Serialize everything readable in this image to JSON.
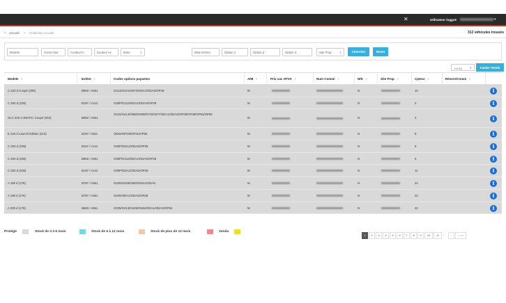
{
  "topbar": {
    "user_label": "Utilisateur loggué",
    "caret": "▾",
    "logo": "✕"
  },
  "breadcrumb": {
    "home": "Accueil",
    "separator": ">",
    "current": "Collection Accueil",
    "count_label": "312 véhicules trouvés"
  },
  "filters": {
    "fields": [
      "Modele",
      "Comm Nur",
      "Couleur in",
      "Couleur ex",
      "Boite",
      "Date Entree",
      "Option 1",
      "Option 2",
      "Option 3",
      "Site Prop"
    ],
    "search_label": "Chercher",
    "reset_label": "Reset"
  },
  "table_controls": {
    "lot": "Lot 10",
    "hide_label": "Cacher Vendu"
  },
  "columns": [
    "Modele",
    "Ext/Int",
    "Codes options payantes",
    "A/M",
    "Prix cat. HTVA",
    "Num Commi",
    "N/D",
    "Site Prop",
    "Cpteur",
    "Réserv/Comm"
  ],
  "rows": [
    {
      "modele": "C 220 d Coupé (205)",
      "extint": "B992 / A651",
      "options": "O413/O421/O873/ODA1/ODAS/OP49",
      "am": "M",
      "nd": "N",
      "cpteur": "10"
    },
    {
      "modele": "C 200 d (205)",
      "extint": "B197 / A141",
      "options": "O30P/O413/ODA1/ODAS/OP29",
      "am": "M",
      "nd": "N",
      "cpteur": "4"
    },
    {
      "modele": "GLC 220 d 4MATIC Coupé (253)",
      "extint": "B992 / A651",
      "options": "O234/O414/O550/O608/O73/O877/ODA1/ODAS/OP29/OP49/OP54/OP65",
      "am": "M",
      "nd": "N",
      "cpteur": "3"
    },
    {
      "modele": "E 220 d Launch Edition (213)",
      "extint": "B197 / A811",
      "options": "ODK5/OP29/OP31/OP55",
      "am": "M",
      "nd": "N",
      "cpteur": "8"
    },
    {
      "modele": "C 200 d (205)",
      "extint": "B197 / A141",
      "options": "O30P/ODA1/ODAS/OP29",
      "am": "M",
      "nd": "N",
      "cpteur": "8"
    },
    {
      "modele": "C 200 d (205)",
      "extint": "B992 / A651",
      "options": "O30P/O413/ODA1/ODAS/OP29",
      "am": "M",
      "nd": "N",
      "cpteur": "6"
    },
    {
      "modele": "C 200 d (205)",
      "extint": "B197 / A141",
      "options": "O30P/ODA1/ODAS/OP29",
      "am": "M",
      "nd": "N",
      "cpteur": "11"
    },
    {
      "modele": "A 180 d (176)",
      "extint": "B787 / A651",
      "options": "O235/O429/O840/ODA1/ODAS",
      "am": "M",
      "nd": "N",
      "cpteur": "22"
    },
    {
      "modele": "A 180 d (176)",
      "extint": "B787 / A361",
      "options": "O235/ODA1/ODAS/OR38",
      "am": "M",
      "nd": "N",
      "cpteur": "22"
    },
    {
      "modele": "A 200 d (176)",
      "extint": "B650 / A651",
      "options": "O235/O413/O429/O646/ODA1/ODAS/OP55",
      "am": "M",
      "nd": "N",
      "cpteur": "22"
    }
  ],
  "legend": [
    {
      "label": "Protégé",
      "color": "#d9d9d9"
    },
    {
      "label": "Stock de 3 à 6 mois",
      "color": "#7fd3e6"
    },
    {
      "label": "Stock de 6 à 12 mois",
      "color": "#f5c6a5"
    },
    {
      "label": "Stock de plus de 12 mois",
      "color": "#ee8a8a"
    },
    {
      "label": "Vendu",
      "color": "#f2d935"
    }
  ],
  "pagination": {
    "pages": [
      "1",
      "2",
      "3",
      "4",
      "5",
      "6",
      "7",
      "8",
      "9",
      "10",
      "11"
    ],
    "ellipsis": "...",
    "next": "»",
    "last": "Last",
    "active": "1"
  },
  "colors": {
    "accent": "#3aaed8",
    "info": "#1a6fd6",
    "topbar": "#2a2a2a",
    "topbar_border": "#c0392b"
  }
}
